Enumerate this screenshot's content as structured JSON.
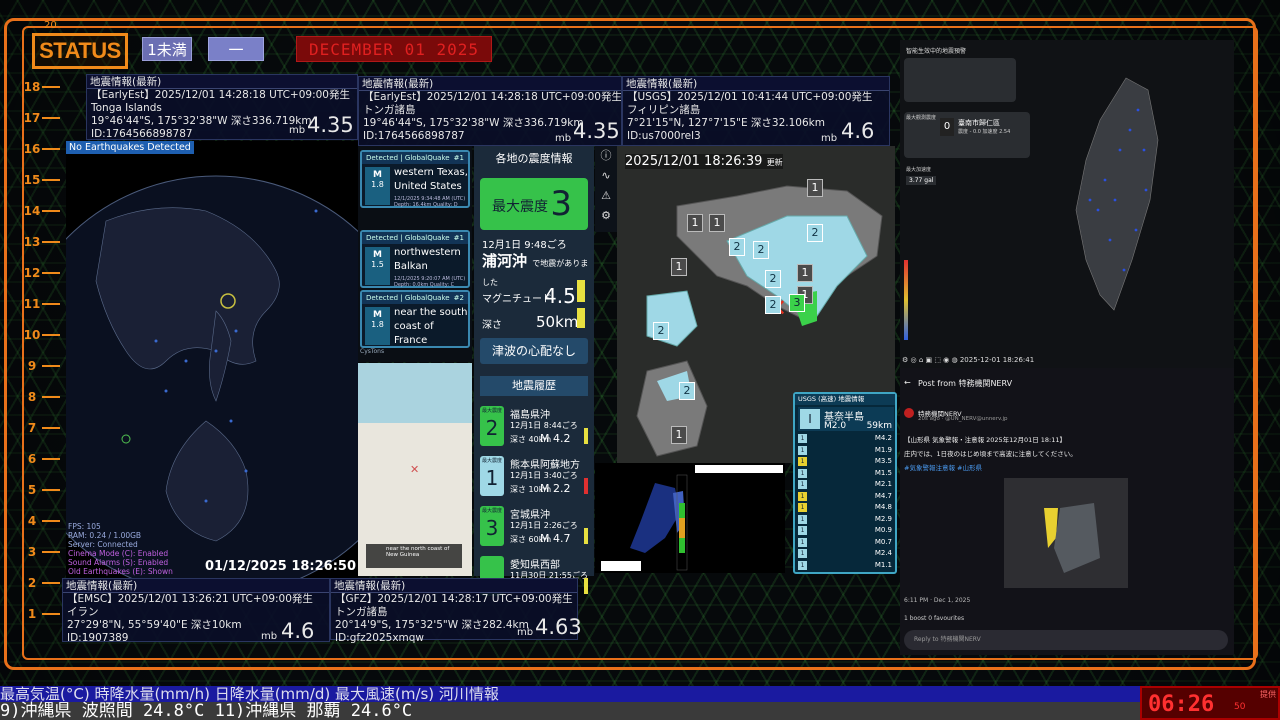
{
  "header": {
    "logo": "STATUS",
    "badge_a": "1未満",
    "badge_b": "一",
    "date": "DECEMBER 01 2025",
    "corner_num": "20"
  },
  "ruler": [
    "18",
    "17",
    "16",
    "15",
    "14",
    "13",
    "12",
    "11",
    "10",
    "9",
    "8",
    "7",
    "6",
    "5",
    "4",
    "3",
    "2",
    "1"
  ],
  "quake_cards": {
    "card1": {
      "header": "地震情報(最新)",
      "line1": "【EarlyEst】2025/12/01  14:28:18  UTC+09:00発生",
      "line2": "Tonga Islands",
      "line3": "19°46'44\"S,  175°32'38\"W   深さ336.719km",
      "line4": "ID:1764566898787",
      "mb": "mb",
      "mag": "4.35"
    },
    "card2": {
      "header": "地震情報(最新)",
      "line1": "【EarlyEst】2025/12/01  14:28:18  UTC+09:00発生",
      "line2": "トンガ諸島",
      "line3": "19°46'44\"S,  175°32'38\"W   深さ336.719km",
      "line4": "ID:1764566898787",
      "mb": "mb",
      "mag": "4.35"
    },
    "card3": {
      "header": "地震情報(最新)",
      "line1": "【USGS】2025/12/01  10:41:44  UTC+09:00発生",
      "line2": "フィリピン諸島",
      "line3": "7°21'15\"N,  127°7'15\"E   深さ32.106km",
      "line4": "ID:us7000rel3",
      "mb": "mb",
      "mag": "4.6"
    },
    "card4": {
      "header": "地震情報(最新)",
      "line1": "【EMSC】2025/12/01  13:26:21  UTC+09:00発生",
      "line2": "イラン",
      "line3": "27°29'8\"N,  55°59'40\"E   深さ10km",
      "line4": "ID:1907389",
      "mb": "mb",
      "mag": "4.6"
    },
    "card5": {
      "header": "地震情報(最新)",
      "line1": "【GFZ】2025/12/01  14:28:17  UTC+09:00発生",
      "line2": "トンガ諸島",
      "line3": "20°14'9\"S,  175°32'5\"W   深さ282.4km",
      "line4": "ID:gfz2025xmqw",
      "mb": "mb",
      "mag": "4.63"
    }
  },
  "globe": {
    "no_detect": "No Earthquakes Detected",
    "timestamp": "01/12/2025 18:26:50",
    "debug": [
      "FPS: 105",
      "RAM: 0.24 / 1.00GB",
      "Server: Connected",
      "Cinema Mode (C): Enabled",
      "Sound Alarms (S): Enabled",
      "Old Earthquakes (E): Shown"
    ]
  },
  "globalquake": {
    "items": [
      {
        "title": "Detected | GlobalQuake",
        "num": "#1",
        "m_label": "M",
        "mag": "1.8",
        "place": "western Texas, United States",
        "meta1": "12/1/2025 9:34:48 AM (UTC)",
        "meta2": "Depth: 16.4km    Quality: D"
      },
      {
        "title": "Detected | GlobalQuake",
        "num": "#1",
        "m_label": "M",
        "mag": "1.5",
        "place": "northwestern Balkan",
        "meta1": "12/1/2025 9:20:07 AM (UTC)",
        "meta2": "Depth: 0.0km    Quality: C"
      },
      {
        "title": "Detected | GlobalQuake",
        "num": "#2",
        "m_label": "M",
        "mag": "1.8",
        "place": "near the south coast of France",
        "meta1": "",
        "meta2": ""
      }
    ],
    "footer": "CysTons"
  },
  "osm": {
    "info": "near the north coast of New Guinea"
  },
  "shindo": {
    "title": "各地の震度情報",
    "max_label": "最大震度",
    "max_value": "3",
    "datetime": "12月1日 9:48ごろ",
    "epicenter": "浦河沖",
    "epicenter_note": "で地震がありました",
    "mag_label": "マグニチュード",
    "mag_value": "4.5",
    "depth_label": "深さ",
    "depth_value": "50km",
    "tsunami": "津波の心配なし",
    "history_title": "地震履歴",
    "history": [
      {
        "label": "最大震度",
        "shindo": "2",
        "place": "福島県沖",
        "date": "12月1日 8:44ごろ",
        "depth": "深さ  40km",
        "mag": "M 4.2",
        "color": "#36c24a",
        "mark": "#e8e040"
      },
      {
        "label": "最大震度",
        "shindo": "1",
        "place": "熊本県阿蘇地方",
        "date": "12月1日 3:40ごろ",
        "depth": "深さ  10km",
        "mag": "M 2.2",
        "color": "#9fd8e6",
        "mark": "#e03030"
      },
      {
        "label": "最大震度",
        "shindo": "3",
        "place": "宮城県沖",
        "date": "12月1日 2:26ごろ",
        "depth": "深さ  60km",
        "mag": "M 4.7",
        "color": "#36c24a",
        "mark": "#e8e040"
      },
      {
        "label": "",
        "shindo": "",
        "place": "愛知県西部",
        "date": "11月30日 21:55ごろ",
        "depth": "",
        "mag": "",
        "color": "#36c24a",
        "mark": "#e8e040"
      }
    ]
  },
  "map": {
    "clock": "2025/12/01  18:26:39",
    "clock_suffix": "更新"
  },
  "usgs_list": {
    "header": "USGS (高速) 地震情報",
    "top_place": "基奈半島",
    "top_mag": "M2.0",
    "top_depth": "59km",
    "items": [
      {
        "s": "1",
        "mag": "M4.2"
      },
      {
        "s": "1",
        "mag": "M1.9"
      },
      {
        "s": "1",
        "mag": "M3.5"
      },
      {
        "s": "1",
        "mag": "M1.5"
      },
      {
        "s": "1",
        "mag": "M2.1"
      },
      {
        "s": "1",
        "mag": "M4.7"
      },
      {
        "s": "1",
        "mag": "M4.8"
      },
      {
        "s": "1",
        "mag": "M2.9"
      },
      {
        "s": "1",
        "mag": "M0.9"
      },
      {
        "s": "1",
        "mag": "M0.7"
      },
      {
        "s": "1",
        "mag": "M2.4"
      },
      {
        "s": "1",
        "mag": "M1.1"
      }
    ]
  },
  "taiwan": {
    "head": "智能生效中的地震預警",
    "stat_label1": "最大觀測震度",
    "stat_value": "0",
    "stat_place": "臺南市歸仁區",
    "stat_detail": "震度 - 0.0    加速度 2.54",
    "stat_label2": "最大加速度",
    "stat_value2": "3.77 gal",
    "controls": "⚙  ◎  ⌂  ▣  ⬚  ◉  ◍  2025-12-01 18:26:41"
  },
  "xpost": {
    "title": "Post from 特務機関NERV",
    "name": "特務機関NERV",
    "handle": "20s ago · @UN_NERV@unnerv.jp",
    "body1": "【山形県 気象警報・注意報 2025年12月01日 18:11】",
    "body2": "庄内では、1日夜のはじめ頃まで高波に注意してください。",
    "tags": "#気象警報注意報  #山形県",
    "meta": "6:11 PM · Dec 1, 2025",
    "stats": "1 boost    0 favourites",
    "reply": "Reply to 特務機関NERV"
  },
  "ticker": {
    "line1": "最高気温(°C)  時降水量(mm/h)    日降水量(mm/d)    最大風速(m/s)    河川情報",
    "line2": "    9)沖縄県 波照間 24.8°C       11)沖縄県 那覇 24.6°C"
  },
  "clock": {
    "time": "06:26",
    "sec": "50",
    "side": "提供"
  }
}
